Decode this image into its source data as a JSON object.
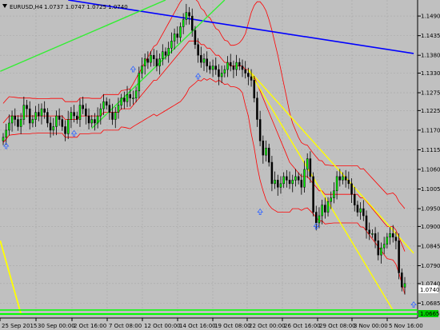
{
  "header": {
    "symbol": "EURUSD,H4",
    "ohlc": "1.0737 1.0747 1.0725 1.0740"
  },
  "price_axis": {
    "labels": [
      "1.1490",
      "1.1435",
      "1.1380",
      "1.1330",
      "1.1275",
      "1.1225",
      "1.1170",
      "1.1115",
      "1.1060",
      "1.1005",
      "1.0950",
      "1.0900",
      "1.0845",
      "1.0790",
      "1.0740",
      "1.0685"
    ],
    "current_price": "1.0740",
    "bottom_tag": "1.0665"
  },
  "time_axis": {
    "labels": [
      "25 Sep 2015",
      "30 Sep 00:00",
      "2 Oct 16:00",
      "7 Oct 08:00",
      "12 Oct 00:00",
      "14 Oct 16:00",
      "19 Oct 08:00",
      "22 Oct 00:00",
      "26 Oct 16:00",
      "29 Oct 08:00",
      "3 Nov 00:00",
      "5 Nov 16:00"
    ]
  },
  "chart_data": {
    "type": "candlestick",
    "symbol": "EURUSD",
    "timeframe": "H4",
    "ylim": [
      1.065,
      1.1535
    ],
    "closes": [
      1.115,
      1.117,
      1.119,
      1.121,
      1.12,
      1.118,
      1.12,
      1.124,
      1.123,
      1.119,
      1.12,
      1.122,
      1.121,
      1.123,
      1.122,
      1.119,
      1.117,
      1.118,
      1.121,
      1.12,
      1.118,
      1.116,
      1.12,
      1.122,
      1.121,
      1.12,
      1.124,
      1.123,
      1.121,
      1.119,
      1.12,
      1.119,
      1.121,
      1.123,
      1.125,
      1.124,
      1.122,
      1.12,
      1.122,
      1.124,
      1.126,
      1.125,
      1.127,
      1.126,
      1.126,
      1.128,
      1.133,
      1.135,
      1.137,
      1.136,
      1.138,
      1.137,
      1.135,
      1.137,
      1.139,
      1.138,
      1.14,
      1.142,
      1.144,
      1.143,
      1.146,
      1.148,
      1.15,
      1.149,
      1.145,
      1.141,
      1.138,
      1.136,
      1.137,
      1.135,
      1.134,
      1.135,
      1.134,
      1.132,
      1.133,
      1.134,
      1.136,
      1.135,
      1.134,
      1.136,
      1.135,
      1.134,
      1.133,
      1.132,
      1.131,
      1.126,
      1.12,
      1.114,
      1.11,
      1.112,
      1.108,
      1.102,
      1.103,
      1.101,
      1.102,
      1.104,
      1.103,
      1.102,
      1.103,
      1.104,
      1.103,
      1.101,
      1.106,
      1.109,
      1.104,
      1.094,
      1.091,
      1.093,
      1.096,
      1.094,
      1.097,
      1.098,
      1.1,
      1.104,
      1.103,
      1.104,
      1.103,
      1.102,
      1.099,
      1.096,
      1.094,
      1.095,
      1.093,
      1.089,
      1.088,
      1.088,
      1.086,
      1.082,
      1.084,
      1.085,
      1.087,
      1.088,
      1.087,
      1.086,
      1.077,
      1.073,
      1.074
    ],
    "bollinger_mid": [
      1.119,
      1.12,
      1.121,
      1.121,
      1.121,
      1.121,
      1.121,
      1.121,
      1.121,
      1.121,
      1.121,
      1.121,
      1.121,
      1.121,
      1.121,
      1.121,
      1.121,
      1.121,
      1.121,
      1.121,
      1.121,
      1.12,
      1.12,
      1.12,
      1.12,
      1.12,
      1.121,
      1.121,
      1.121,
      1.121,
      1.121,
      1.121,
      1.121,
      1.121,
      1.122,
      1.122,
      1.122,
      1.122,
      1.122,
      1.122,
      1.123,
      1.123,
      1.123,
      1.123,
      1.124,
      1.125,
      1.126,
      1.127,
      1.128,
      1.129,
      1.13,
      1.131,
      1.131,
      1.132,
      1.133,
      1.134,
      1.135,
      1.136,
      1.137,
      1.138,
      1.139,
      1.14,
      1.141,
      1.142,
      1.142,
      1.142,
      1.142,
      1.141,
      1.141,
      1.14,
      1.14,
      1.139,
      1.138,
      1.138,
      1.137,
      1.136,
      1.136,
      1.135,
      1.135,
      1.135,
      1.135,
      1.135,
      1.134,
      1.134,
      1.133,
      1.132,
      1.13,
      1.128,
      1.126,
      1.124,
      1.122,
      1.12,
      1.118,
      1.116,
      1.114,
      1.112,
      1.11,
      1.108,
      1.107,
      1.106,
      1.105,
      1.104,
      1.104,
      1.104,
      1.103,
      1.102,
      1.101,
      1.1,
      1.1,
      1.099,
      1.099,
      1.099,
      1.099,
      1.099,
      1.099,
      1.099,
      1.099,
      1.099,
      1.099,
      1.099,
      1.099,
      1.098,
      1.098,
      1.097,
      1.096,
      1.095,
      1.094,
      1.093,
      1.092,
      1.091,
      1.09,
      1.09,
      1.09,
      1.089,
      1.087,
      1.085,
      1.083
    ],
    "bollinger_width": [
      0.0055,
      0.0055,
      0.0054,
      0.0053,
      0.0052,
      0.0051,
      0.005,
      0.005,
      0.005,
      0.005,
      0.0049,
      0.0049,
      0.0048,
      0.0048,
      0.0048,
      0.0048,
      0.0049,
      0.0049,
      0.0049,
      0.0049,
      0.0049,
      0.005,
      0.005,
      0.005,
      0.005,
      0.005,
      0.005,
      0.005,
      0.005,
      0.005,
      0.0049,
      0.0049,
      0.0049,
      0.0049,
      0.005,
      0.005,
      0.005,
      0.005,
      0.005,
      0.005,
      0.0051,
      0.0052,
      0.0054,
      0.0056,
      0.006,
      0.0065,
      0.007,
      0.0075,
      0.008,
      0.0085,
      0.009,
      0.0095,
      0.01,
      0.0105,
      0.011,
      0.0115,
      0.012,
      0.0125,
      0.013,
      0.0135,
      0.014,
      0.014,
      0.0138,
      0.0132,
      0.0125,
      0.0118,
      0.011,
      0.0102,
      0.0095,
      0.009,
      0.0085,
      0.008,
      0.0075,
      0.007,
      0.0065,
      0.0062,
      0.006,
      0.0058,
      0.0058,
      0.006,
      0.0065,
      0.0075,
      0.01,
      0.013,
      0.017,
      0.02,
      0.023,
      0.025,
      0.026,
      0.0265,
      0.026,
      0.025,
      0.0235,
      0.022,
      0.02,
      0.018,
      0.016,
      0.014,
      0.012,
      0.011,
      0.01,
      0.0095,
      0.009,
      0.0088,
      0.0086,
      0.0085,
      0.0085,
      0.0085,
      0.0084,
      0.0083,
      0.0082,
      0.0081,
      0.008,
      0.008,
      0.008,
      0.008,
      0.008,
      0.008,
      0.008,
      0.008,
      0.008,
      0.0081,
      0.0082,
      0.0083,
      0.0084,
      0.0085,
      0.0086,
      0.0087,
      0.0088,
      0.0089,
      0.009,
      0.0092,
      0.0094,
      0.0096,
      0.01,
      0.011,
      0.012
    ]
  },
  "colors": {
    "background": "#c0c0c0",
    "grid": "#a8a8a8",
    "candle": "#000000",
    "bull_body": "#00ff00",
    "bollinger": "#ff0000",
    "blue_trend": "#0000ff",
    "green_trend": "#33ee33",
    "yellow_channel": "#ffff00",
    "fractal_arrow": "#3366ff"
  },
  "icons": {
    "fractal_up": "up-arrow-icon",
    "dropdown": "triangle-down-icon"
  }
}
